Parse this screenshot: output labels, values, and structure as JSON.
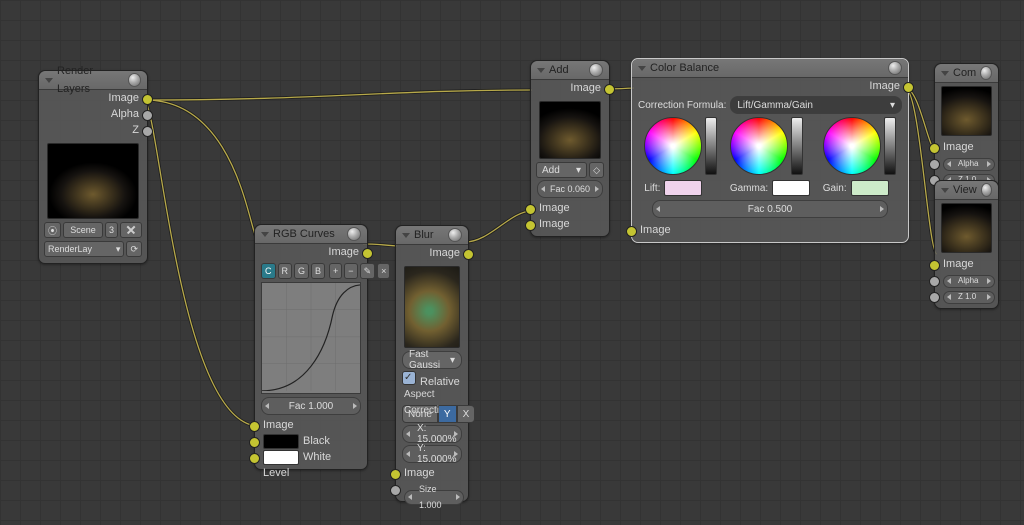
{
  "render_layers": {
    "title": "Render Layers",
    "out_image": "Image",
    "out_alpha": "Alpha",
    "out_z": "Z",
    "scene": "Scene",
    "scene_num": "3",
    "layer_selector": "RenderLay"
  },
  "rgb_curves": {
    "title": "RGB Curves",
    "out_image": "Image",
    "channels": [
      "C",
      "R",
      "G",
      "B"
    ],
    "fac": "Fac 1.000",
    "in_image": "Image",
    "black": "Black Level",
    "white": "White Level"
  },
  "blur": {
    "title": "Blur",
    "out_image": "Image",
    "type": "Fast Gaussi",
    "relative": "Relative",
    "aspect": "Aspect Correcti",
    "axes": [
      "None",
      "Y",
      "X"
    ],
    "xval": "X: 15.000%",
    "yval": "Y: 15.000%",
    "in_image": "Image",
    "size": "Size 1.000"
  },
  "add": {
    "title": "Add",
    "out_image": "Image",
    "mode": "Add",
    "fac": "Fac 0.060",
    "in_image1": "Image",
    "in_image2": "Image"
  },
  "color_balance": {
    "title": "Color Balance",
    "out_image": "Image",
    "formula_label": "Correction Formula:",
    "formula": "Lift/Gamma/Gain",
    "lift": "Lift:",
    "gamma": "Gamma:",
    "gain": "Gain:",
    "fac": "Fac 0.500",
    "in_image": "Image"
  },
  "composite": {
    "title": "Com",
    "in_image": "Image",
    "in_alpha": "Alpha",
    "in_z": "Z 1.0"
  },
  "viewer": {
    "title": "View",
    "in_image": "Image",
    "in_alpha": "Alpha",
    "in_z": "Z 1.0"
  }
}
